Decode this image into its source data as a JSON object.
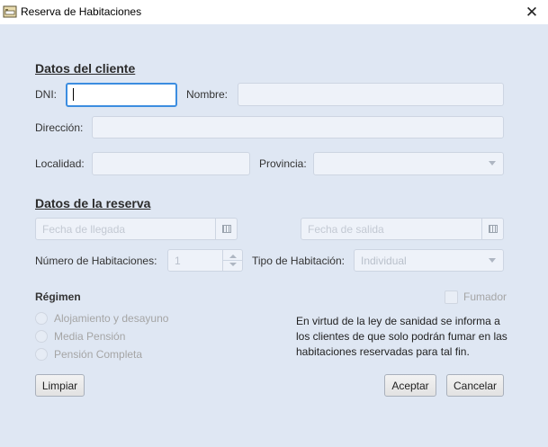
{
  "window": {
    "title": "Reserva de Habitaciones",
    "close_glyph": "✕"
  },
  "cliente": {
    "section_title": "Datos del cliente",
    "dni_label": "DNI:",
    "dni_value": "",
    "nombre_label": "Nombre:",
    "nombre_value": "",
    "direccion_label": "Dirección:",
    "direccion_value": "",
    "localidad_label": "Localidad:",
    "localidad_value": "",
    "provincia_label": "Provincia:",
    "provincia_value": ""
  },
  "reserva": {
    "section_title": "Datos de la reserva",
    "fecha_llegada_placeholder": "Fecha de llegada",
    "fecha_salida_placeholder": "Fecha de salida",
    "num_habitaciones_label": "Número de Habitaciones:",
    "num_habitaciones_value": "1",
    "tipo_habitacion_label": "Tipo de Habitación:",
    "tipo_habitacion_value": "Individual"
  },
  "regimen": {
    "title": "Régimen",
    "options": [
      "Alojamiento y desayuno",
      "Media Pensión",
      "Pensión Completa"
    ],
    "fumador_label": "Fumador",
    "info_lines": [
      "En virtud de la ley de sanidad se informa a",
      "los clientes de que solo podrán fumar en las",
      "habitaciones reservadas para tal fin."
    ]
  },
  "buttons": {
    "limpiar": "Limpiar",
    "aceptar": "Aceptar",
    "cancelar": "Cancelar"
  },
  "icons": {
    "app": "hotel-bed-icon",
    "close": "close-icon",
    "calendar": "calendar-icon"
  },
  "colors": {
    "background": "#dfe7f3",
    "focus": "#3c8de0",
    "disabled_text": "#a5a5a5"
  }
}
